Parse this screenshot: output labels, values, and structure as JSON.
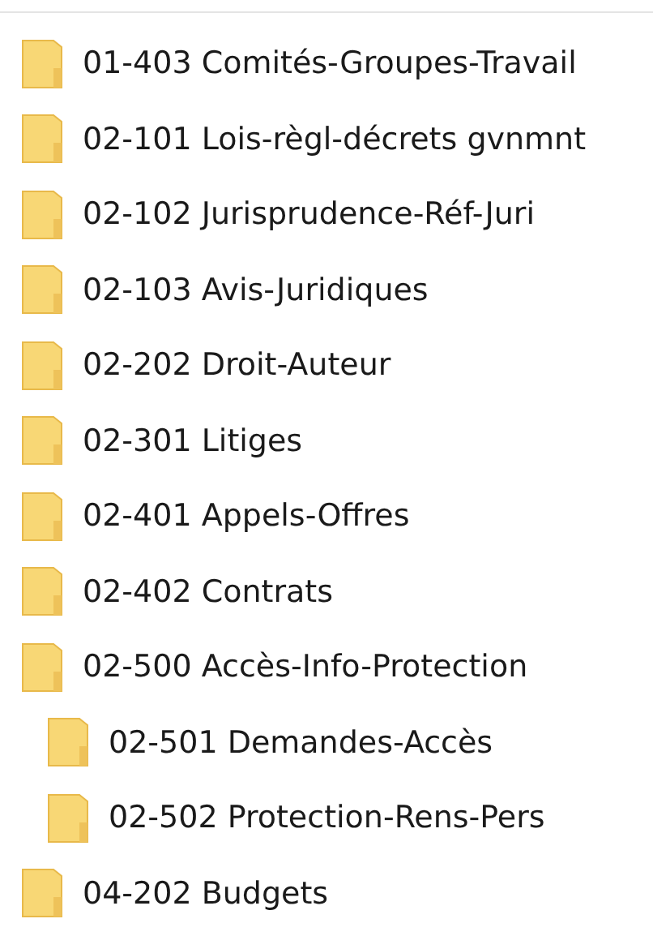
{
  "folders": [
    {
      "label": "01-403 Comités-Groupes-Travail"
    },
    {
      "label": "02-101 Lois-règl-décrets gvnmnt"
    },
    {
      "label": "02-102 Jurisprudence-Réf-Juri"
    },
    {
      "label": "02-103 Avis-Juridiques"
    },
    {
      "label": "02-202 Droit-Auteur"
    },
    {
      "label": "02-301 Litiges"
    },
    {
      "label": "02-401 Appels-Offres"
    },
    {
      "label": "02-402 Contrats"
    },
    {
      "label": "02-500 Accès-Info-Protection",
      "children": [
        {
          "label": "02-501 Demandes-Accès"
        },
        {
          "label": "02-502 Protection-Rens-Pers"
        }
      ]
    },
    {
      "label": "04-202 Budgets"
    }
  ]
}
